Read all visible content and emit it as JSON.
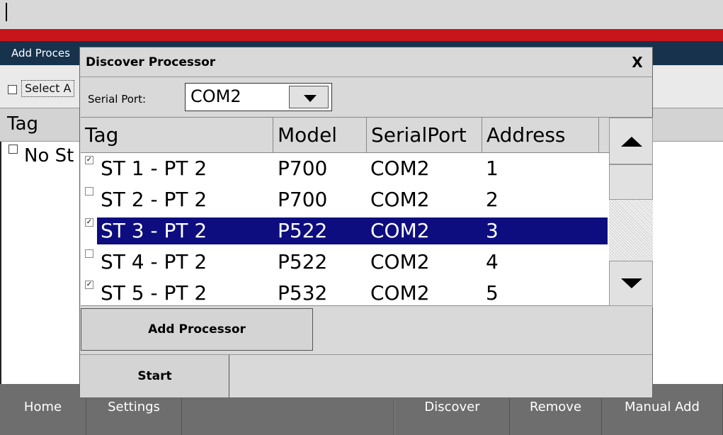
{
  "background": {
    "title": "Add Proces",
    "select_all_label": "Select A",
    "column_tag": "Tag",
    "empty_text": "No St"
  },
  "dialog": {
    "title": "Discover Processor",
    "close_label": "X",
    "serial_port_label": "Serial Port:",
    "serial_port_value": "COM2",
    "columns": [
      "Tag",
      "Model",
      "SerialPort",
      "Address"
    ],
    "rows": [
      {
        "checked": true,
        "selected": false,
        "tag": "ST 1 - PT 2",
        "model": "P700",
        "port": "COM2",
        "address": "1"
      },
      {
        "checked": false,
        "selected": false,
        "tag": "ST 2 - PT 2",
        "model": "P700",
        "port": "COM2",
        "address": "2"
      },
      {
        "checked": true,
        "selected": true,
        "tag": "ST 3 - PT 2",
        "model": "P522",
        "port": "COM2",
        "address": "3"
      },
      {
        "checked": false,
        "selected": false,
        "tag": "ST 4 - PT 2",
        "model": "P522",
        "port": "COM2",
        "address": "4"
      },
      {
        "checked": true,
        "selected": false,
        "tag": "ST 5 - PT 2",
        "model": "P532",
        "port": "COM2",
        "address": "5"
      }
    ],
    "add_processor_label": "Add Processor",
    "start_label": "Start"
  },
  "nav": {
    "home": "Home",
    "settings": "Settings",
    "discover": "Discover",
    "remove": "Remove",
    "manual_add": "Manual Add"
  },
  "colors": {
    "red_band": "#c8151b",
    "title_bar": "#16324d",
    "selection": "#0d0d80",
    "nav_bar": "#6e6e6e"
  }
}
